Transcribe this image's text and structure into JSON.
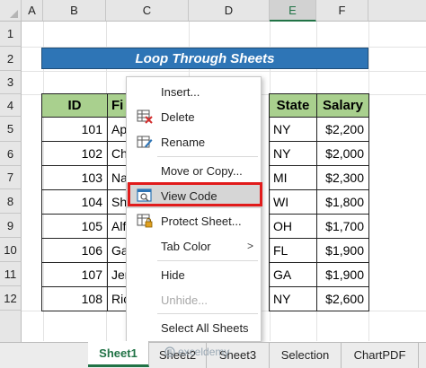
{
  "columns": [
    {
      "label": "A"
    },
    {
      "label": "B"
    },
    {
      "label": "C"
    },
    {
      "label": "D"
    },
    {
      "label": "E"
    },
    {
      "label": "F"
    }
  ],
  "rows": [
    "1",
    "2",
    "3",
    "4",
    "5",
    "6",
    "7",
    "8",
    "9",
    "10",
    "11",
    "12"
  ],
  "title": "Loop Through Sheets",
  "table": {
    "headers": {
      "id": "ID",
      "name": "Fi",
      "state": "State",
      "salary": "Salary"
    },
    "records": [
      {
        "id": "101",
        "name": "Ap",
        "state": "NY",
        "salary": "$2,200"
      },
      {
        "id": "102",
        "name": "Ch",
        "state": "NY",
        "salary": "$2,000"
      },
      {
        "id": "103",
        "name": "Na",
        "state": "MI",
        "salary": "$2,300"
      },
      {
        "id": "104",
        "name": "Sh",
        "state": "WI",
        "salary": "$1,800"
      },
      {
        "id": "105",
        "name": "Alf",
        "state": "OH",
        "salary": "$1,700"
      },
      {
        "id": "106",
        "name": "Ga",
        "state": "FL",
        "salary": "$1,900"
      },
      {
        "id": "107",
        "name": "Jer",
        "state": "GA",
        "salary": "$1,900"
      },
      {
        "id": "108",
        "name": "Ric",
        "state": "NY",
        "salary": "$2,600"
      }
    ]
  },
  "menu": {
    "insert": "Insert...",
    "delete": "Delete",
    "rename": "Rename",
    "move_copy": "Move or Copy...",
    "view_code": "View Code",
    "protect": "Protect Sheet...",
    "tab_color": "Tab Color",
    "hide": "Hide",
    "unhide": "Unhide...",
    "select_all": "Select All Sheets",
    "submenu_arrow": ">"
  },
  "tabs": {
    "sheet1": "Sheet1",
    "sheet2": "Sheet2",
    "sheet3": "Sheet3",
    "selection": "Selection",
    "chartpdf": "ChartPDF"
  },
  "watermark": "exceldemy",
  "colors": {
    "title_bg": "#2e75b6",
    "header_bg": "#a9d08e",
    "highlight_border": "#e11b1b",
    "active_tab": "#217346"
  }
}
